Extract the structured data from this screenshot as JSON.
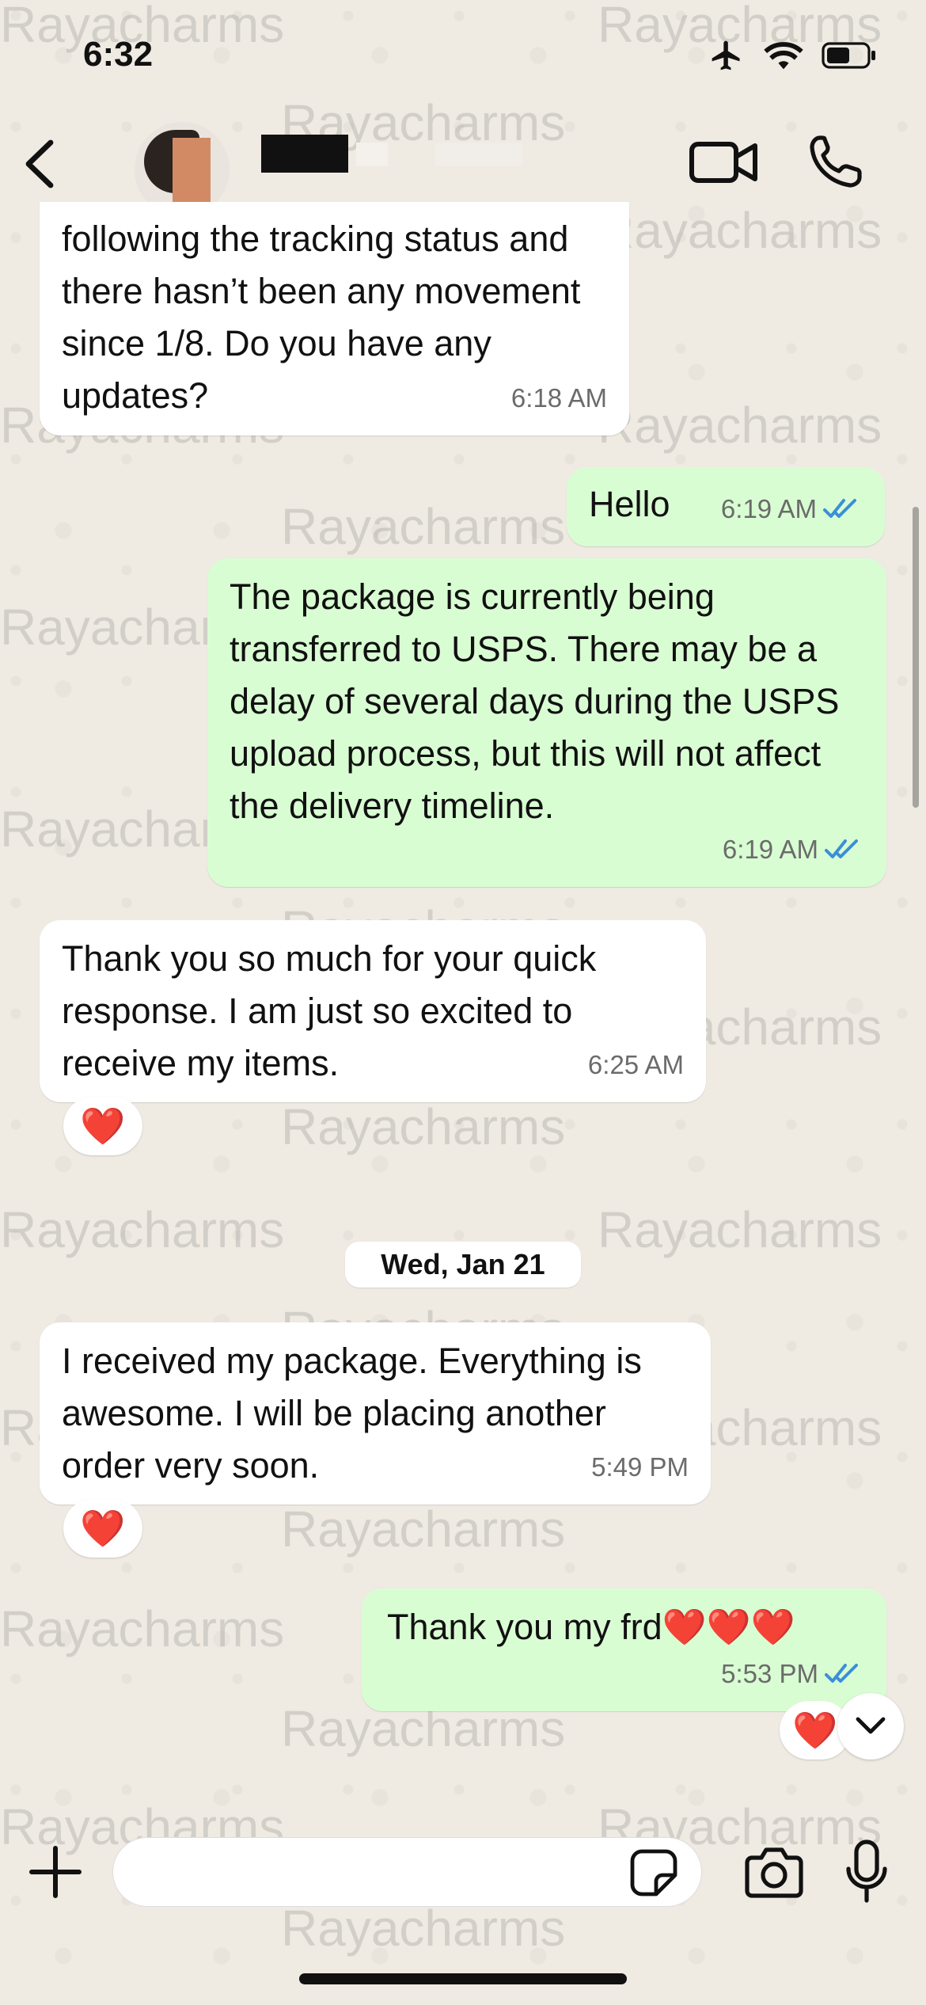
{
  "status_bar": {
    "time": "6:32"
  },
  "watermark": {
    "text": "Rayacharms"
  },
  "messages": [
    {
      "text": "following the tracking status and there hasn’t been any movement since 1/8. Do you have any updates?",
      "time": "6:18 AM",
      "direction": "incoming"
    },
    {
      "text": "Hello",
      "time": "6:19 AM",
      "direction": "outgoing",
      "read": true
    },
    {
      "text": "The package is currently being transferred to USPS. There may be a delay of several days during the USPS upload process, but this will not affect the delivery timeline.",
      "time": "6:19 AM",
      "direction": "outgoing",
      "read": true
    },
    {
      "text": "Thank you so much for your quick response. I am just so excited to receive my items.",
      "time": "6:25 AM",
      "direction": "incoming",
      "reaction": "❤️"
    },
    {
      "text": "I received my package. Everything is awesome. I will be placing another order very soon.",
      "time": "5:49 PM",
      "direction": "incoming",
      "reaction": "❤️"
    },
    {
      "text": "Thank you my frd❤️❤️❤️",
      "time": "5:53 PM",
      "direction": "outgoing",
      "read": true,
      "reaction": "❤️"
    }
  ],
  "date_separator": "Wed, Jan 21",
  "input": {
    "value": "",
    "placeholder": ""
  },
  "colors": {
    "incoming_bubble": "#ffffff",
    "outgoing_bubble": "#d9fdd3",
    "read_ticks": "#3a8fd8",
    "background": "#efeae2"
  },
  "icons": [
    "back-icon",
    "video-call-icon",
    "phone-icon",
    "plus-icon",
    "sticker-icon",
    "camera-icon",
    "microphone-icon",
    "chevron-down-icon",
    "airplane-icon",
    "wifi-icon",
    "battery-icon"
  ]
}
